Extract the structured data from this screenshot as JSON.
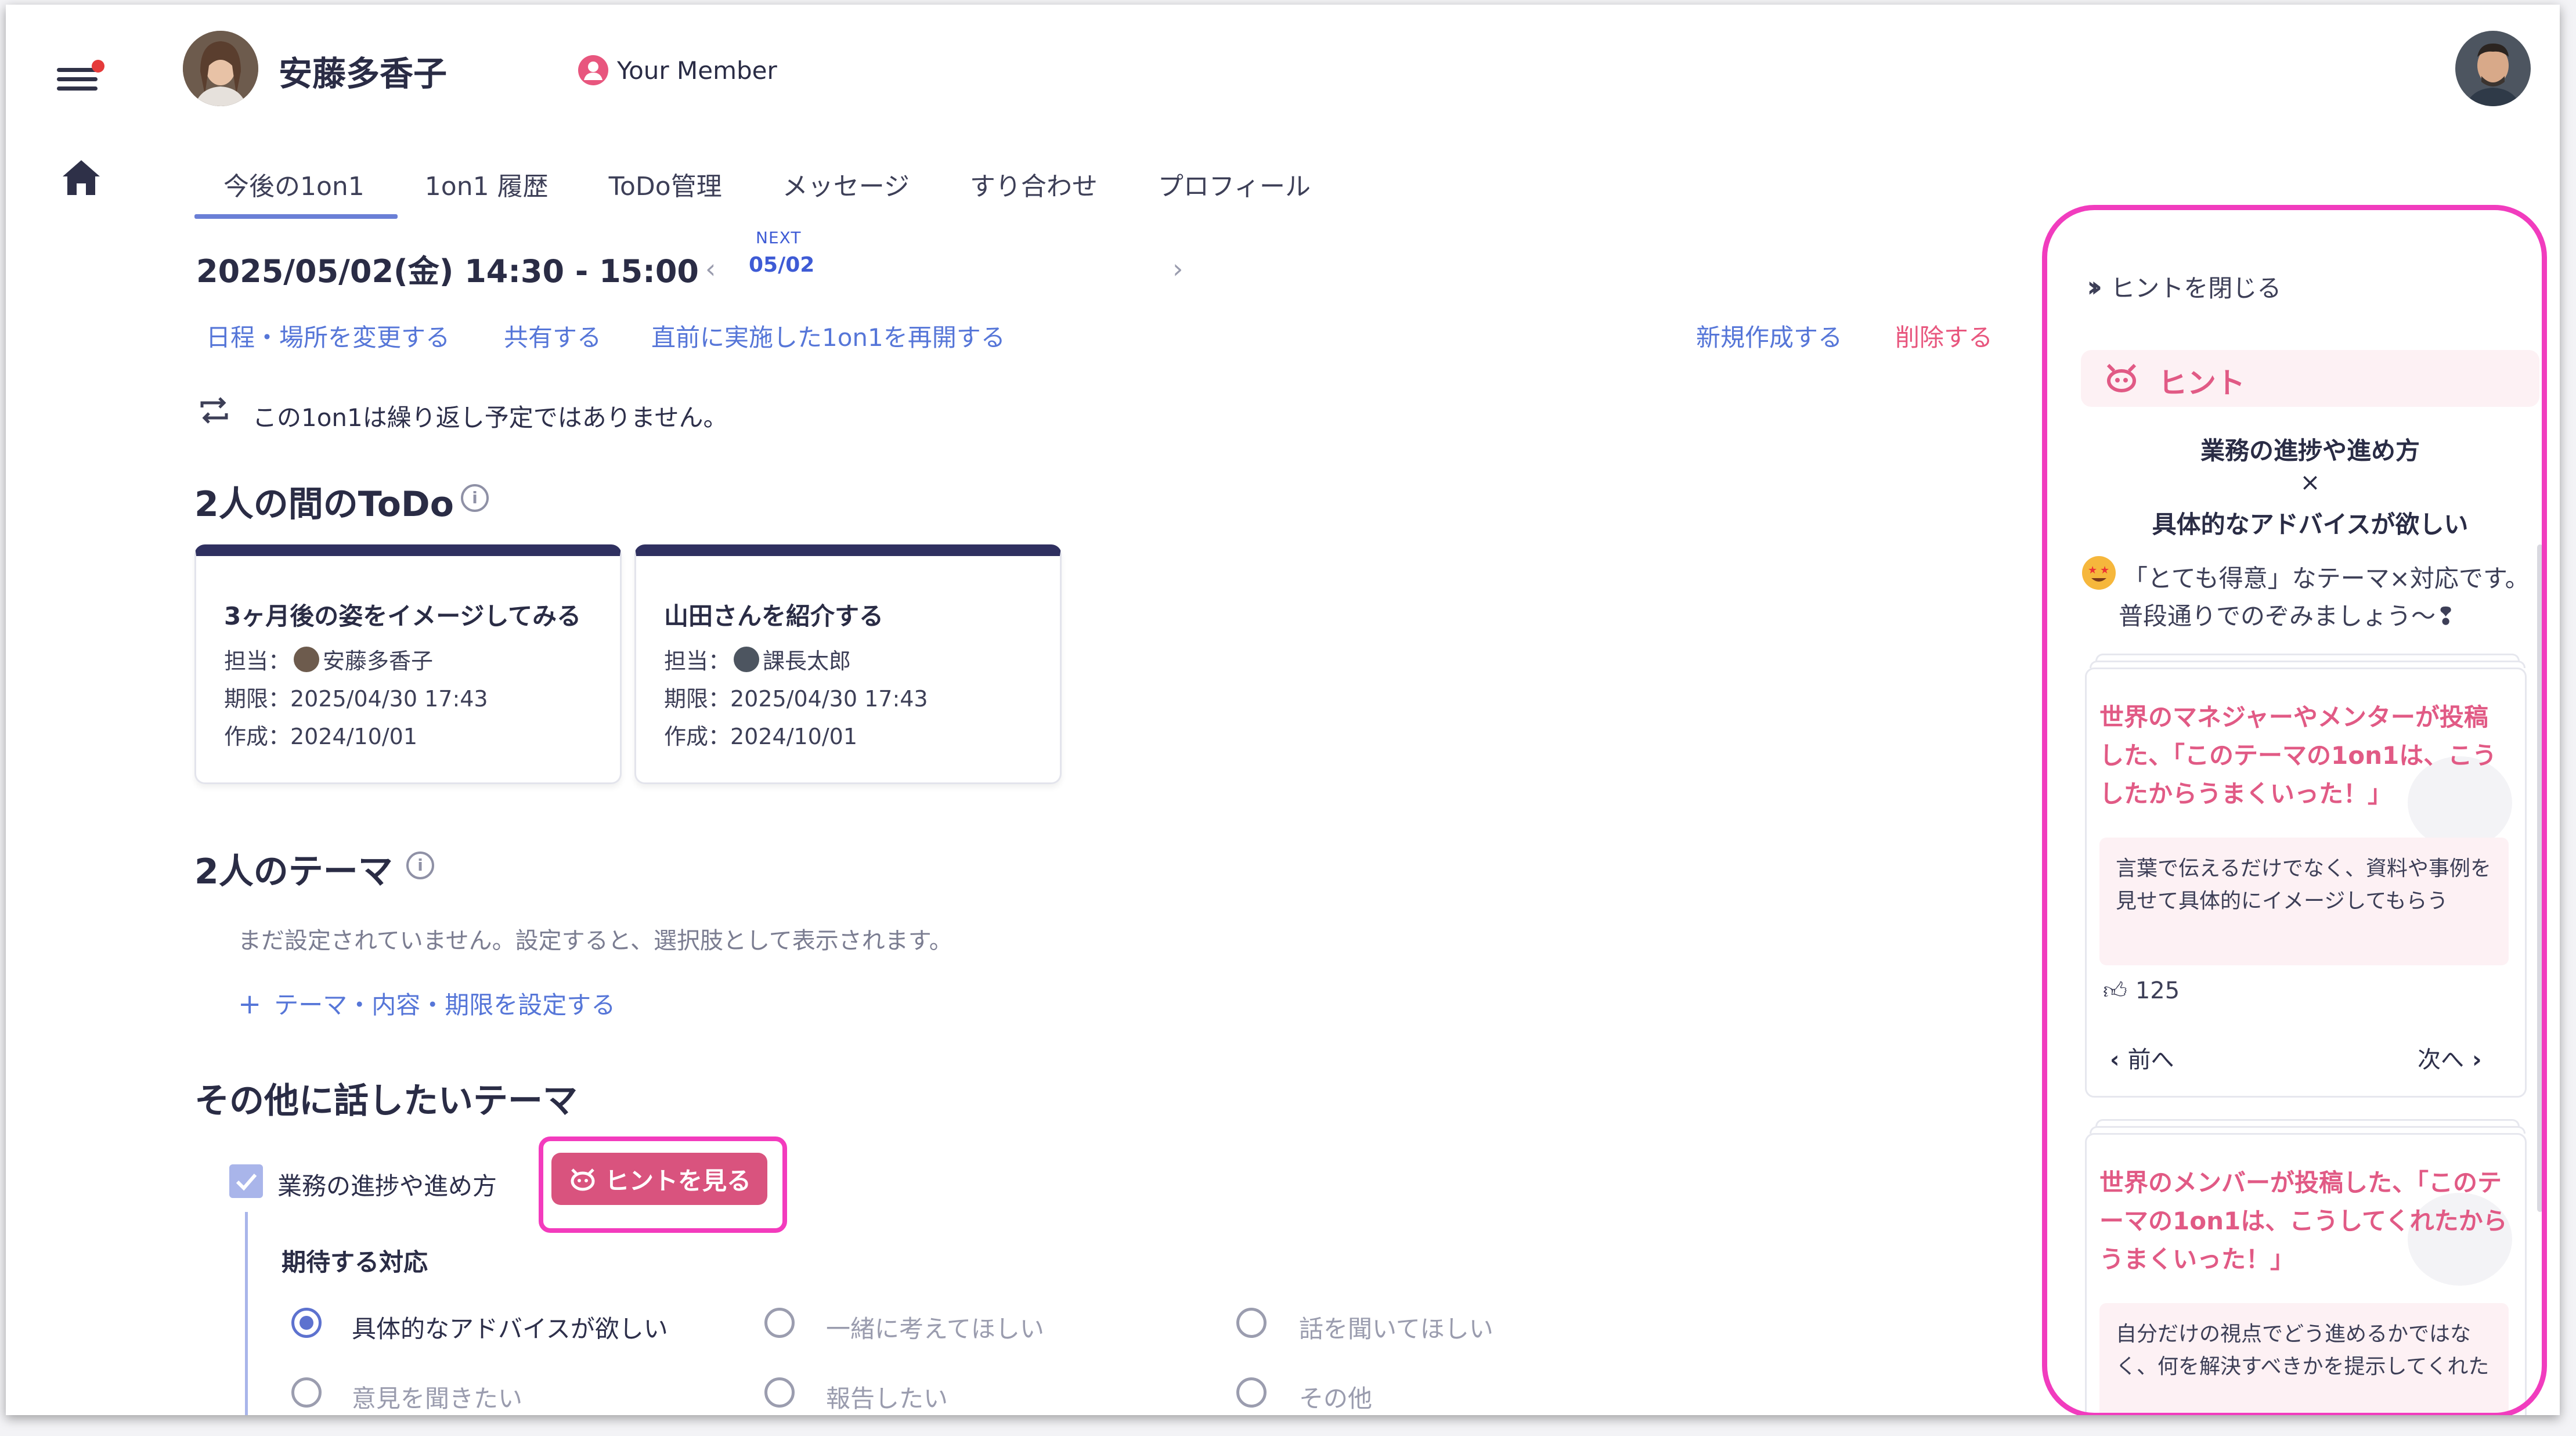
{
  "header": {
    "member_name": "安藤多香子",
    "badge_label": "Your Member"
  },
  "tabs": [
    {
      "label": "今後の1on1",
      "active": true
    },
    {
      "label": "1on1 履歴"
    },
    {
      "label": "ToDo管理"
    },
    {
      "label": "メッセージ"
    },
    {
      "label": "すり合わせ"
    },
    {
      "label": "プロフィール"
    }
  ],
  "meeting": {
    "datetime": "2025/05/02(金) 14:30 - 15:00",
    "next_label": "NEXT",
    "next_date": "05/02",
    "actions": {
      "reschedule": "日程・場所を変更する",
      "share": "共有する",
      "resume": "直前に実施した1on1を再開する",
      "create": "新規作成する",
      "delete": "削除する"
    },
    "repeat_note": "この1on1は繰り返し予定ではありません。"
  },
  "todo": {
    "title": "2人の間のToDo",
    "cards": [
      {
        "title": "3ヶ月後の姿をイメージしてみる",
        "assignee_label": "担当：",
        "assignee": "安藤多香子",
        "due": "期限：2025/04/30 17:43",
        "created": "作成：2024/10/01"
      },
      {
        "title": "山田さんを紹介する",
        "assignee_label": "担当：",
        "assignee": "課長太郎",
        "due": "期限：2025/04/30 17:43",
        "created": "作成：2024/10/01"
      }
    ]
  },
  "theme": {
    "title": "2人のテーマ",
    "empty_note": "まだ設定されていません。設定すると、選択肢として表示されます。",
    "set_link": "テーマ・内容・期限を設定する"
  },
  "other": {
    "title": "その他に話したいテーマ",
    "topic_label": "業務の進捗や進め方",
    "hint_button": "ヒントを見る",
    "expect_title": "期待する対応",
    "options": [
      {
        "label": "具体的なアドバイスが欲しい",
        "selected": true
      },
      {
        "label": "一緒に考えてほしい",
        "selected": false
      },
      {
        "label": "話を聞いてほしい",
        "selected": false
      },
      {
        "label": "意見を聞きたい",
        "selected": false
      },
      {
        "label": "報告したい",
        "selected": false
      },
      {
        "label": "その他",
        "selected": false
      }
    ]
  },
  "hint_panel": {
    "close_label": "ヒントを閉じる",
    "header": "ヒント",
    "topic_line1": "業務の進捗や進め方",
    "times": "×",
    "topic_line2": "具体的なアドバイスが欲しい",
    "message_line1": "「とても得意」なテーマ×対応です。",
    "message_line2": "普段通りでのぞみましょう〜❢",
    "cards": [
      {
        "title": "世界のマネジャーやメンターが投稿した、「このテーマの1on1は、こうしたからうまくいった！」",
        "quote": "言葉で伝えるだけでなく、資料や事例を見せて具体的にイメージしてもらう",
        "likes": "125",
        "prev": "前へ",
        "next": "次へ"
      },
      {
        "title": "世界のメンバーが投稿した、「このテーマの1on1は、こうしてくれたからうまくいった！」",
        "quote": "自分だけの視点でどう進めるかではなく、何を解決すべきかを提示してくれた"
      }
    ]
  },
  "colors": {
    "accent": "#5676d8",
    "hint_pink": "#e15a85",
    "highlight": "#f13cbe",
    "danger": "#e8567e"
  }
}
